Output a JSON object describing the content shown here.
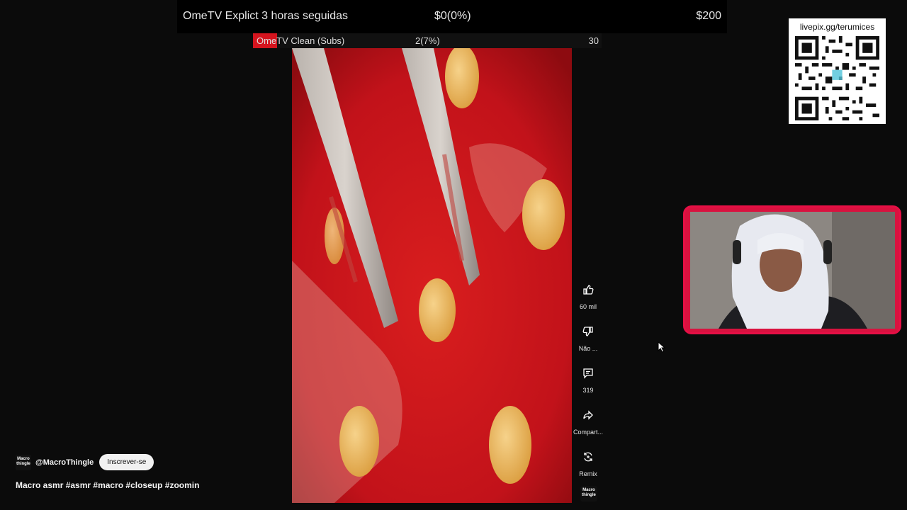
{
  "goal_main": {
    "title": "OmeTV Explict 3 horas seguidas",
    "progress": "$0(0%)",
    "target": "$200"
  },
  "goal_subs": {
    "title": "OmeTV Clean (Subs)",
    "progress": "2(7%)",
    "target": "30",
    "fill_fraction": 0.07,
    "fill_color": "#d4141e"
  },
  "qr": {
    "url": "livepix.gg/terumices"
  },
  "actions": [
    {
      "icon": "thumbs-up-icon",
      "label": "60 mil"
    },
    {
      "icon": "thumbs-down-icon",
      "label": "Não ..."
    },
    {
      "icon": "comment-icon",
      "label": "319"
    },
    {
      "icon": "share-icon",
      "label": "Compart..."
    },
    {
      "icon": "remix-icon",
      "label": "Remix"
    }
  ],
  "channel": {
    "avatar_text": "Macro thingle",
    "handle": "@MacroThingle",
    "subscribe_label": "Inscrever-se"
  },
  "video": {
    "title": "Macro asmr #asmr #macro #closeup #zoomin"
  },
  "colors": {
    "cam_border": "#e60f45",
    "goal_fill": "#d4141e"
  }
}
